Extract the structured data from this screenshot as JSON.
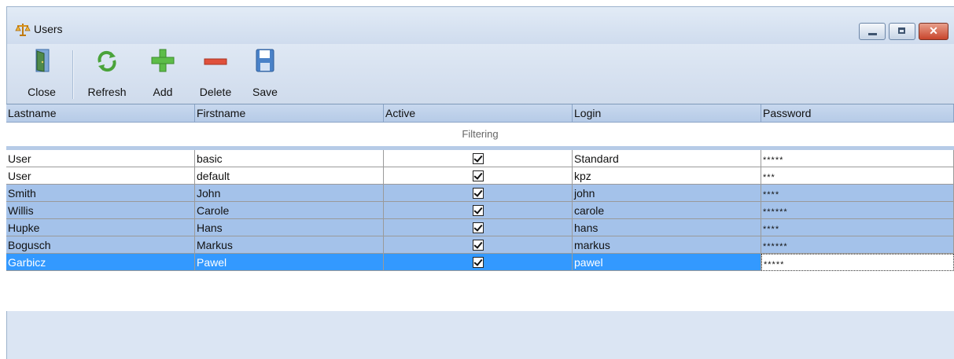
{
  "window": {
    "title": "Users"
  },
  "toolbar": {
    "buttons": [
      {
        "label": "Close"
      },
      {
        "label": "Refresh"
      },
      {
        "label": "Add"
      },
      {
        "label": "Delete"
      },
      {
        "label": "Save"
      }
    ]
  },
  "grid": {
    "columns": [
      "Lastname",
      "Firstname",
      "Active",
      "Login",
      "Password"
    ],
    "filter_label": "Filtering",
    "rows": [
      {
        "lastname": "User",
        "firstname": "basic",
        "active": true,
        "login": "Standard",
        "password": "*****"
      },
      {
        "lastname": "User",
        "firstname": "default",
        "active": true,
        "login": "kpz",
        "password": "***"
      },
      {
        "lastname": "Smith",
        "firstname": "John",
        "active": true,
        "login": "john",
        "password": "****"
      },
      {
        "lastname": "Willis",
        "firstname": "Carole",
        "active": true,
        "login": "carole",
        "password": "******"
      },
      {
        "lastname": "Hupke",
        "firstname": "Hans",
        "active": true,
        "login": "hans",
        "password": "****"
      },
      {
        "lastname": "Bogusch",
        "firstname": "Markus",
        "active": true,
        "login": "markus",
        "password": "******"
      },
      {
        "lastname": "Garbicz",
        "firstname": "Pawel",
        "active": true,
        "login": "pawel",
        "password": "*****"
      }
    ]
  },
  "colors": {
    "selected_row": "#3399ff",
    "alt_row": "#a4c2ea",
    "header": "#b6cbe7"
  }
}
